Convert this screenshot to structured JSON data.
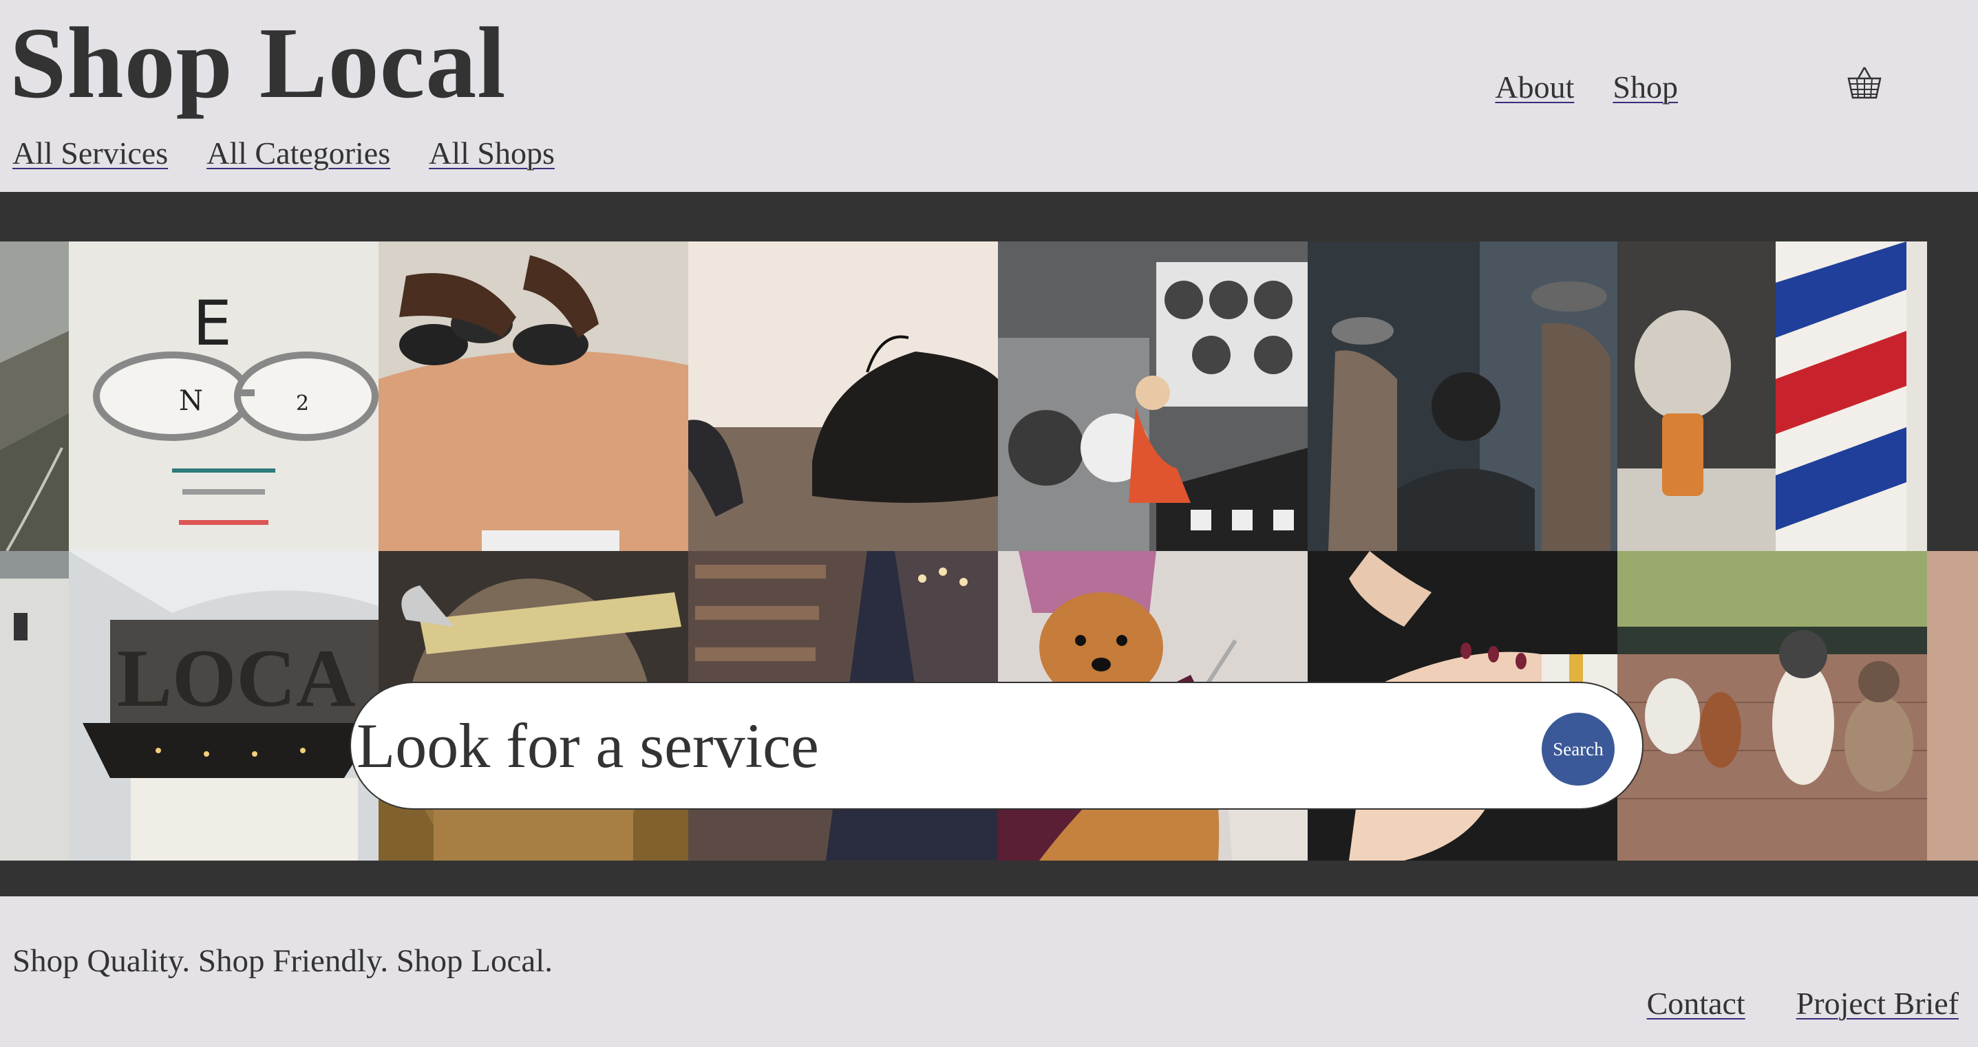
{
  "header": {
    "title": "Shop Local",
    "subnav": [
      "All Services",
      "All Categories",
      "All Shops"
    ],
    "topnav": [
      "About",
      "Shop"
    ],
    "cart_icon": "basket-icon"
  },
  "search": {
    "placeholder": "Look for a service",
    "button_label": "Search",
    "button_color": "#3b5998"
  },
  "gallery": {
    "top_row": [
      "eye-chart-glasses",
      "hot-stone-massage",
      "dress-shoes",
      "laundromat",
      "barbershop",
      "barber-pole-shaving-brush"
    ],
    "bottom_row": [
      "local-sign",
      "haircut-comb",
      "library-shelves",
      "dog-grooming",
      "manicure",
      "dog-walking"
    ],
    "sign_text": "LOCA"
  },
  "footer": {
    "tagline": "Shop Quality. Shop Friendly. Shop Local.",
    "links": [
      "Contact",
      "Project Brief"
    ]
  },
  "colors": {
    "background": "#e4e2e6",
    "band": "#333333",
    "accent": "#3b5998"
  }
}
